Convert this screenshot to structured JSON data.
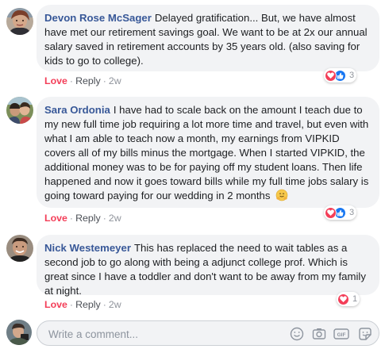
{
  "comments": [
    {
      "author": "Devon Rose McSager",
      "text": "Delayed gratification... But, we have almost have met our retirement savings goal. We want to be at 2x our annual salary saved in retirement accounts by 35 years old. (also saving for kids to go to college).",
      "love_label": "Love",
      "reply_label": "Reply",
      "time": "2w",
      "reaction_icons": [
        "love-icon",
        "like-icon"
      ],
      "reaction_count": "3"
    },
    {
      "author": "Sara Ordonia",
      "text": "I have had to scale back on the amount I teach due to my new full time job requiring a lot more time and travel, but even with what I am able to teach now a month, my earnings from VIPKID covers all of my bills minus the mortgage. When I started VIPKID, the additional money was to be for paying off my student loans. Then life happened and now it goes toward bills while my full time jobs salary is going toward paying for our wedding in 2 months",
      "emoji": "hugging-face-emoji",
      "love_label": "Love",
      "reply_label": "Reply",
      "time": "2w",
      "reaction_icons": [
        "love-icon",
        "like-icon"
      ],
      "reaction_count": "3"
    },
    {
      "author": "Nick Westemeyer",
      "text": "This has replaced the need to wait tables as a second job to go along with being a adjunct college prof. Which is great since I have a toddler and don't want to be away from my family at night.",
      "love_label": "Love",
      "reply_label": "Reply",
      "time": "2w",
      "reaction_icons": [
        "love-icon"
      ],
      "reaction_count": "1"
    }
  ],
  "composer": {
    "placeholder": "Write a comment...",
    "icons": [
      "emoji-icon",
      "camera-icon",
      "gif-icon",
      "sticker-icon"
    ]
  },
  "colors": {
    "author": "#385898",
    "love": "#f33e58",
    "like": "#1877f2",
    "bubble": "#f2f3f5",
    "meta": "#90949c"
  }
}
